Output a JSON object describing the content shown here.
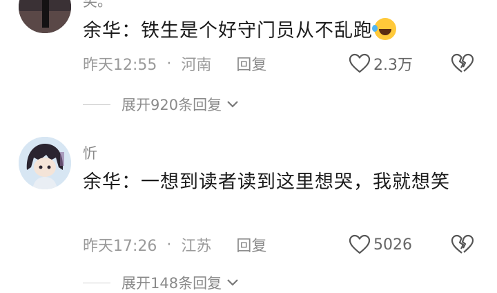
{
  "comments": [
    {
      "username": "笑。",
      "text": "余华：铁生是个好守门员从不乱跑",
      "emoji": "rolling-on-floor-laughing-emoji",
      "time": "昨天12:55",
      "separator": "·",
      "location": "河南",
      "reply_label": "回复",
      "likes": "2.3万",
      "expand_label": "展开920条回复"
    },
    {
      "username": "忻",
      "text": "余华：一想到读者读到这里想哭，我就想笑",
      "time": "昨天17:26",
      "separator": "·",
      "location": "江苏",
      "reply_label": "回复",
      "likes": "5026",
      "expand_label": "展开148条回复"
    }
  ],
  "icons": {
    "like": "heart-outline-icon",
    "dislike": "broken-heart-icon",
    "expand": "chevron-down-icon"
  }
}
